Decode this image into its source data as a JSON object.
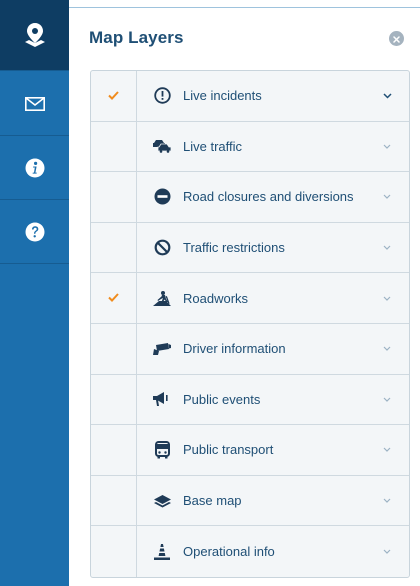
{
  "rail": {
    "items": [
      {
        "name": "map-layers-icon",
        "active": true
      },
      {
        "name": "envelope-icon",
        "active": false
      },
      {
        "name": "info-icon",
        "active": false
      },
      {
        "name": "help-icon",
        "active": false
      }
    ]
  },
  "panel": {
    "title": "Map Layers",
    "close_icon": "close-icon"
  },
  "layers": [
    {
      "label": "Live incidents",
      "icon": "alert-circle-icon",
      "checked": true,
      "expanded_hover": true
    },
    {
      "label": "Live traffic",
      "icon": "cars-icon",
      "checked": false
    },
    {
      "label": "Road closures and diversions",
      "icon": "no-entry-icon",
      "checked": false
    },
    {
      "label": "Traffic restrictions",
      "icon": "prohibited-icon",
      "checked": false
    },
    {
      "label": "Roadworks",
      "icon": "roadworks-icon",
      "checked": true
    },
    {
      "label": "Driver information",
      "icon": "camera-icon",
      "checked": false
    },
    {
      "label": "Public events",
      "icon": "megaphone-icon",
      "checked": false
    },
    {
      "label": "Public transport",
      "icon": "bus-icon",
      "checked": false
    },
    {
      "label": "Base map",
      "icon": "layers-icon",
      "checked": false
    },
    {
      "label": "Operational info",
      "icon": "cone-icon",
      "checked": false
    }
  ],
  "colors": {
    "rail_bg": "#1c6fad",
    "rail_active": "#0e3d63",
    "text": "#1f4f75",
    "check": "#f08c1e",
    "icon": "#1f3b57",
    "chevron": "#9bb2c4"
  }
}
